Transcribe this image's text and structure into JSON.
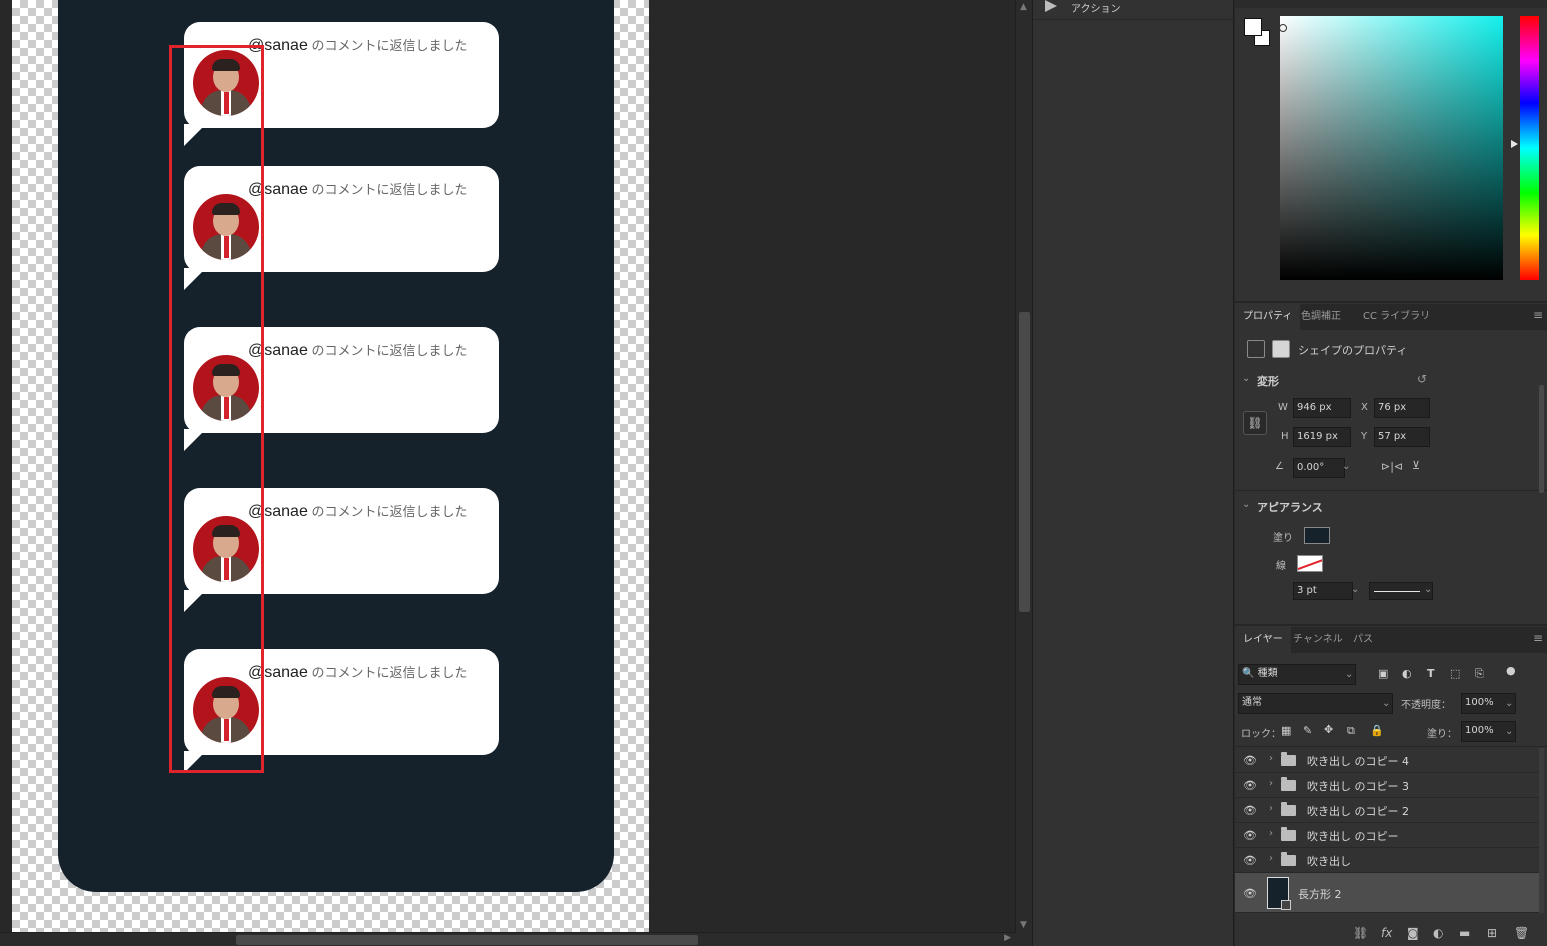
{
  "canvas": {
    "bubbles": [
      {
        "handle": "@sanae",
        "text": " のコメントに返信しました"
      },
      {
        "handle": "@sanae",
        "text": " のコメントに返信しました"
      },
      {
        "handle": "@sanae",
        "text": " のコメントに返信しました"
      },
      {
        "handle": "@sanae",
        "text": " のコメントに返信しました"
      },
      {
        "handle": "@sanae",
        "text": " のコメントに返信しました"
      }
    ],
    "shape_fill_color": "#15212b",
    "highlight_color": "#e0242b"
  },
  "actions_panel": {
    "item_label": "アクション"
  },
  "color_picker": {
    "foreground": "#ffffff",
    "background": "#ffffff",
    "hue_color": "#14f0ec"
  },
  "properties": {
    "tabs": [
      "プロパティ",
      "色調補正",
      "CC ライブラリ"
    ],
    "shape_title": "シェイプのプロパティ",
    "transform": {
      "section": "変形",
      "w_label": "W",
      "w_value": "946 px",
      "h_label": "H",
      "h_value": "1619 px",
      "x_label": "X",
      "x_value": "76 px",
      "y_label": "Y",
      "y_value": "57 px",
      "angle_value": "0.00°"
    },
    "appearance": {
      "section": "アピアランス",
      "fill_label": "塗り",
      "stroke_label": "線",
      "stroke_width": "3 pt"
    }
  },
  "layers": {
    "tabs": [
      "レイヤー",
      "チャンネル",
      "パス"
    ],
    "filter_label": "種類",
    "blend_mode": "通常",
    "opacity_label": "不透明度：",
    "opacity_value": "100%",
    "lock_label": "ロック：",
    "fill_label": "塗り：",
    "fill_value": "100%",
    "items": [
      {
        "name": "吹き出し のコピー 4"
      },
      {
        "name": "吹き出し のコピー 3"
      },
      {
        "name": "吹き出し のコピー 2"
      },
      {
        "name": "吹き出し のコピー"
      },
      {
        "name": "吹き出し"
      }
    ],
    "shape_layer": {
      "name": "長方形 2"
    }
  }
}
